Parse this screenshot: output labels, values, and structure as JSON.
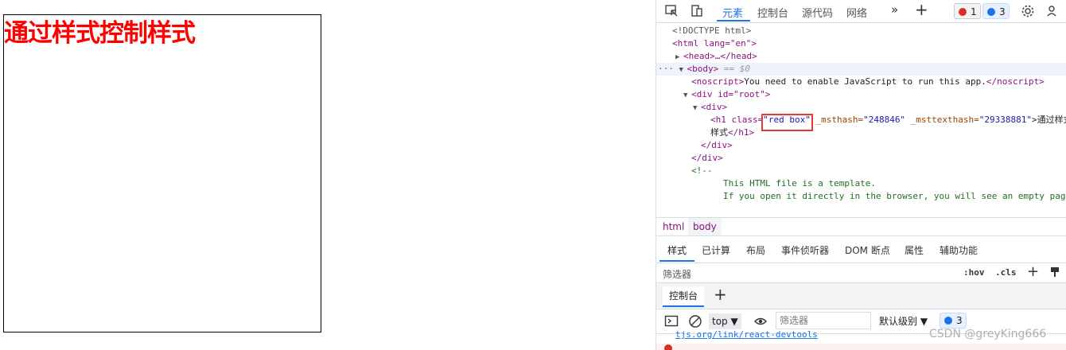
{
  "preview": {
    "heading": "通过样式控制样式"
  },
  "devtools": {
    "tabs": [
      "元素",
      "控制台",
      "源代码",
      "网络"
    ],
    "more": "»",
    "add": "+",
    "error_count": "1",
    "message_count": "3",
    "dom": {
      "doctype": "<!DOCTYPE html>",
      "html_open": "<html lang=\"en\">",
      "head": "<head>…</head>",
      "body_open": "<body>",
      "body_eq": "== $0",
      "noscript_open": "<noscript>",
      "noscript_text": "You need to enable JavaScript to run this app.",
      "noscript_close": "</noscript>",
      "div_root": "<div id=\"root\">",
      "div_open": "<div>",
      "h1_tag": "<h1 class=",
      "h1_class": "\"red box\"",
      "h1_attr1": " _msthash=",
      "h1_attr1_val": "\"248846\"",
      "h1_attr2": " _msttexthash=",
      "h1_attr2_val": "\"29338881\"",
      "h1_text_start": ">通过样式",
      "h1_text_end": "样式",
      "h1_close": "</h1>",
      "div_close": "</div>",
      "div_root_close": "</div>",
      "comment_open": "<!--",
      "comment_line1": "This HTML file is a template.",
      "comment_line2": "If you open it directly in the browser, you will see an empty page"
    },
    "crumbs": [
      "html",
      "body"
    ],
    "style_tabs": [
      "样式",
      "已计算",
      "布局",
      "事件侦听器",
      "DOM 断点",
      "属性",
      "辅助功能"
    ],
    "filter_label": "筛选器",
    "hov": ":hov",
    "cls": ".cls",
    "drawer_tab": "控制台",
    "console": {
      "context": "top",
      "filter_placeholder": "筛选器",
      "level": "默认级别",
      "count": "3",
      "log_link": "tjs.org/link/react-devtools"
    }
  },
  "watermark": "CSDN @greyKing666"
}
